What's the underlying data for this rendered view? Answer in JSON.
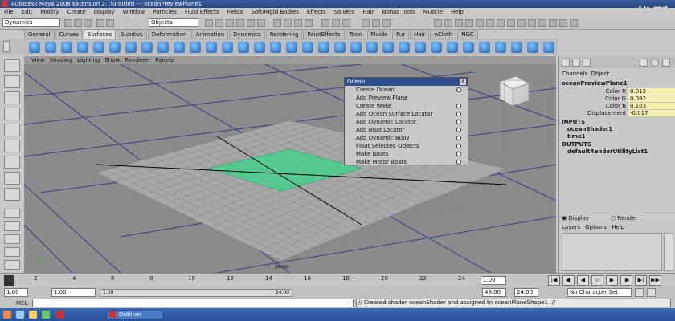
{
  "window": {
    "title": "Autodesk Maya 2008 Extension 2: .\\untitled   ---   oceanPreviewPlane1"
  },
  "watermark": "优酷",
  "menubar": [
    "File",
    "Edit",
    "Modify",
    "Create",
    "Display",
    "Window",
    "Particles",
    "Fluid Effects",
    "Fields",
    "Soft/Rigid Bodies",
    "Effects",
    "Solvers",
    "Hair",
    "Bonus Tools",
    "Muscle",
    "Help"
  ],
  "statusline": {
    "module": "Dynamics",
    "selection_mode": "Objects"
  },
  "shelf_tabs": [
    "General",
    "Curves",
    "Surfaces",
    "Subdivs",
    "Deformation",
    "Animation",
    "Dynamics",
    "Rendering",
    "PaintEffects",
    "Toon",
    "Fluids",
    "Fur",
    "Hair",
    "nCloth",
    "NGC"
  ],
  "active_shelf_tab": "Surfaces",
  "viewport": {
    "menu": [
      "View",
      "Shading",
      "Lighting",
      "Show",
      "Renderer",
      "Panels"
    ],
    "camera_label": "persp",
    "axis_label": "Y  Z  X"
  },
  "ocean_menu": {
    "title": "Ocean",
    "close": "x",
    "items": [
      {
        "label": "Create Ocean",
        "has_option": true
      },
      {
        "label": "Add Preview Plane",
        "has_option": false
      },
      {
        "label": "Create Wake",
        "has_option": true
      },
      {
        "label": "Add Ocean Surface Locator",
        "has_option": true
      },
      {
        "label": "Add Dynamic Locator",
        "has_option": true
      },
      {
        "label": "Add Boat Locator",
        "has_option": true
      },
      {
        "label": "Add Dynamic Buoy",
        "has_option": true
      },
      {
        "label": "Float Selected Objects",
        "has_option": true
      },
      {
        "label": "Make Boats",
        "has_option": true
      },
      {
        "label": "Make Motor Boats",
        "has_option": true
      }
    ]
  },
  "channel_box": {
    "tabs": [
      "Channels",
      "Object"
    ],
    "object": "oceanPreviewPlane1",
    "attrs": [
      {
        "name": "Color R",
        "value": "0.012"
      },
      {
        "name": "Color G",
        "value": "0.092"
      },
      {
        "name": "Color B",
        "value": "0.103"
      },
      {
        "name": "Displacement",
        "value": "-0.017"
      }
    ],
    "inputs_label": "INPUTS",
    "inputs": [
      "oceanShader1",
      "time1"
    ],
    "outputs_label": "OUTPUTS",
    "outputs": [
      "defaultRenderUtilityList1"
    ],
    "layer_display": "Display",
    "layer_render": "Render",
    "layer_menu": [
      "Layers",
      "Options",
      "Help"
    ]
  },
  "timeslider": {
    "ticks": [
      "2",
      "4",
      "6",
      "8",
      "10",
      "12",
      "14",
      "16",
      "18",
      "20",
      "22",
      "24"
    ],
    "current_time": "1.00"
  },
  "range": {
    "start": "1.00",
    "playback_start": "1.00",
    "playback_end": "24.00",
    "end": "48.00",
    "anim_end": "24.00",
    "character": "No Character Set"
  },
  "mel": {
    "label": "MEL",
    "feedback": "// Created shader oceanShader and assigned to oceanPlaneShape1. //"
  },
  "taskbar": {
    "item": "Outliner"
  }
}
